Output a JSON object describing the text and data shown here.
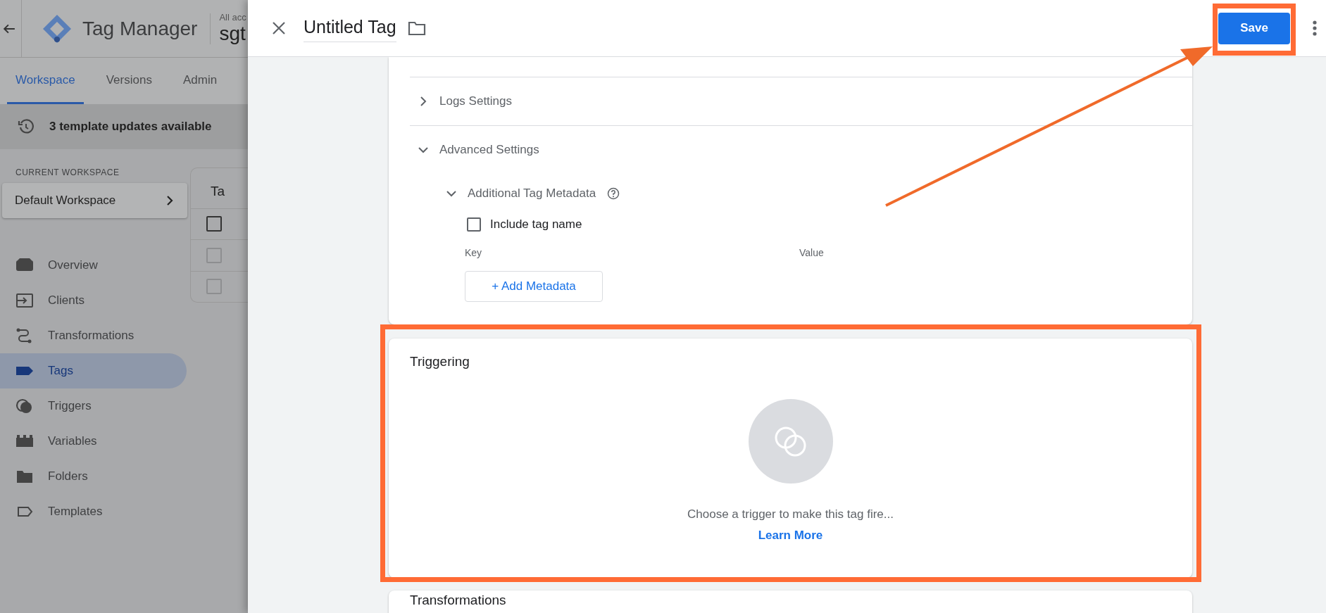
{
  "app": {
    "title": "Tag Manager",
    "account_label": "All acc",
    "container": "sgt"
  },
  "tabs": [
    {
      "label": "Workspace",
      "selected": true
    },
    {
      "label": "Versions",
      "selected": false
    },
    {
      "label": "Admin",
      "selected": false
    }
  ],
  "banner": {
    "text": "3 template updates available"
  },
  "workspace": {
    "label": "CURRENT WORKSPACE",
    "name": "Default Workspace"
  },
  "nav": [
    {
      "label": "Overview",
      "kind": "overview",
      "selected": false
    },
    {
      "label": "Clients",
      "kind": "clients",
      "selected": false
    },
    {
      "label": "Transformations",
      "kind": "transformations",
      "selected": false
    },
    {
      "label": "Tags",
      "kind": "tags",
      "selected": true
    },
    {
      "label": "Triggers",
      "kind": "triggers",
      "selected": false
    },
    {
      "label": "Variables",
      "kind": "variables",
      "selected": false
    },
    {
      "label": "Folders",
      "kind": "folders",
      "selected": false
    },
    {
      "label": "Templates",
      "kind": "templates",
      "selected": false
    }
  ],
  "background_card": {
    "title": "Ta",
    "checkboxes": [
      {
        "checked": false
      },
      {
        "checked": false
      },
      {
        "checked": false
      }
    ]
  },
  "sheet": {
    "title": "Untitled Tag",
    "save": "Save"
  },
  "config": {
    "sections": [
      {
        "label": "Logs Settings",
        "expanded": false
      },
      {
        "label": "Advanced Settings",
        "expanded": true
      }
    ],
    "metadata": {
      "label": "Additional Tag Metadata",
      "expanded": true,
      "include_tag_name": {
        "label": "Include tag name",
        "checked": false
      },
      "columns": [
        "Key",
        "Value"
      ],
      "add_button": "+ Add Metadata"
    }
  },
  "triggering": {
    "title": "Triggering",
    "message": "Choose a trigger to make this tag fire...",
    "link": "Learn More"
  },
  "transformations": {
    "title": "Transformations"
  }
}
